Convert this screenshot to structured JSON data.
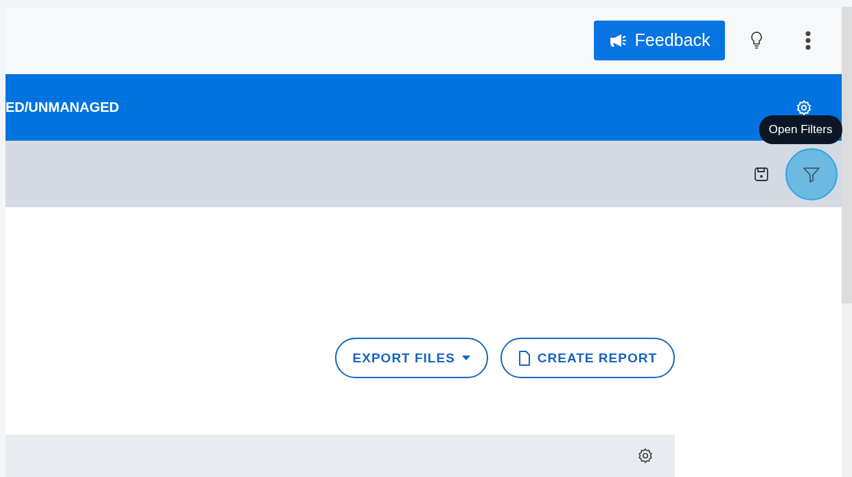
{
  "top_bar": {
    "feedback_button": {
      "label": "Feedback"
    }
  },
  "header": {
    "title": "ED/UNMANAGED"
  },
  "toolbar": {
    "tooltip": "Open Filters"
  },
  "actions": [
    {
      "label": "EXPORT FILES",
      "kind": "dropdown"
    },
    {
      "label": "CREATE REPORT",
      "kind": "document"
    }
  ]
}
